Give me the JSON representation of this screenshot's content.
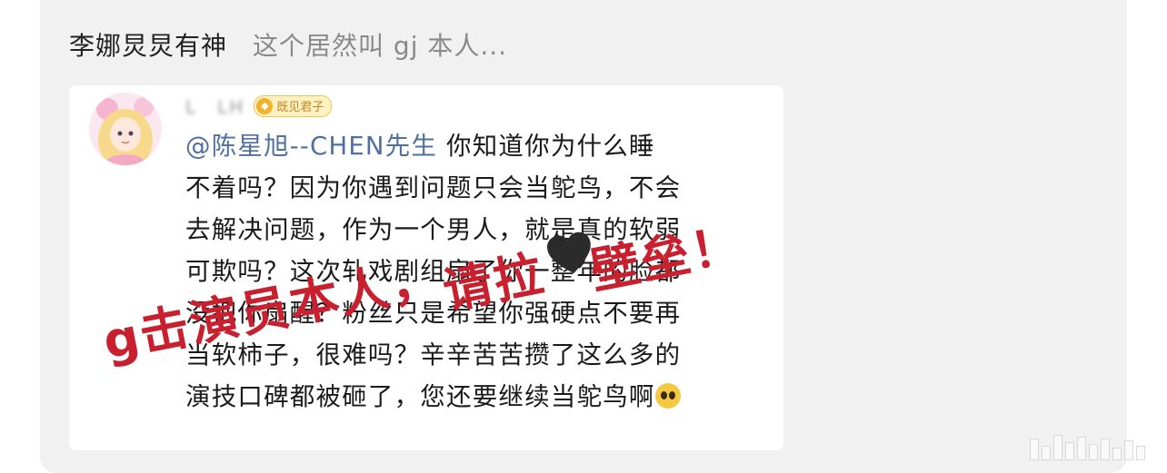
{
  "post": {
    "author": "李娜炅炅有神",
    "snippet": "这个居然叫 gj 本人..."
  },
  "screenshot": {
    "username_blurred": "L　LH",
    "badge_text": "既见君子",
    "badge_icon": "coin-icon",
    "mention": "@陈星旭--CHEN先生",
    "comment_lines": [
      " 你知道你为什么睡",
      "不着吗？因为你遇到问题只会当鸵鸟，不会",
      "去解决问题，作为一个男人，就是真的软弱",
      "可欺吗？这次轧戏剧组扇了你一整年的脸都",
      "没把你扇醒？粉丝只是希望你强硬点不要再",
      "当软柿子，很难吗？辛辛苦苦攒了这么多的",
      "演技口碑都被砸了，您还要继续当鸵鸟啊"
    ],
    "trailing_emoji": "crying-face-icon"
  },
  "overlay": {
    "text_left": "g击演员本人，",
    "text_right_a": "请拉",
    "text_right_b": "壁垒！",
    "heart_icon": "black-heart-icon",
    "color": "#c9202f"
  },
  "colors": {
    "card_bg": "#f1f1f1",
    "mention": "#4f6fa0",
    "author": "#222222",
    "snippet": "#8a8a8a"
  }
}
